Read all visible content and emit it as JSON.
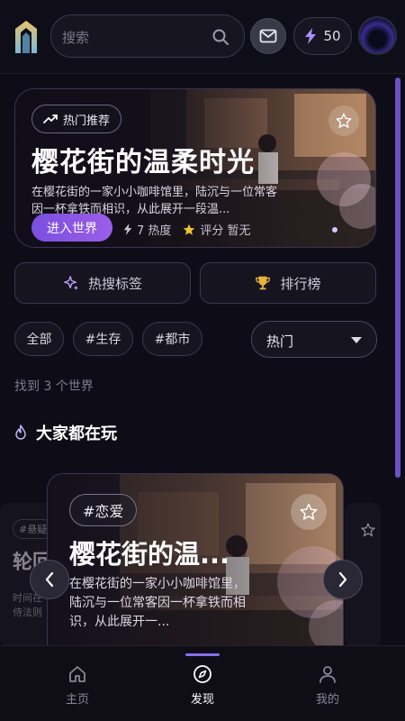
{
  "header": {
    "search_placeholder": "搜索",
    "energy_value": "50"
  },
  "hero": {
    "badge": "热门推荐",
    "title": "樱花街的温柔时光",
    "description": "在樱花街的一家小小咖啡馆里，陆沉与一位常客因一杯拿铁而相识，从此展开一段温...",
    "enter_label": "进入世界",
    "heat": "7 热度",
    "rating": "评分 暂无"
  },
  "actions": {
    "hot_tags": "热搜标签",
    "ranking": "排行榜"
  },
  "filters": {
    "chips": [
      "全部",
      "#生存",
      "#都市"
    ],
    "sort_value": "热门"
  },
  "result_count": "找到 3 个世界",
  "section": {
    "title": "大家都在玩"
  },
  "carousel": {
    "left_card": {
      "tag": "#悬疑",
      "title": "轮回",
      "desc_line1": "时间在",
      "desc_line2": "侍法则"
    },
    "main_card": {
      "tag": "#恋爱",
      "title": "樱花街的温...",
      "description": "在樱花街的一家小小咖啡馆里，陆沉与一位常客因一杯拿铁而相识，从此展开一..."
    }
  },
  "tabbar": {
    "items": [
      {
        "label": "主页",
        "icon": "home-icon"
      },
      {
        "label": "发现",
        "icon": "compass-icon"
      },
      {
        "label": "我的",
        "icon": "user-icon"
      }
    ],
    "active_index": 1
  },
  "colors": {
    "accent": "#8b6cf0",
    "background": "#0e0d17",
    "button_gradient_start": "#7a4fe0",
    "button_gradient_end": "#9b5ee8",
    "star_gold": "#f2c230"
  }
}
